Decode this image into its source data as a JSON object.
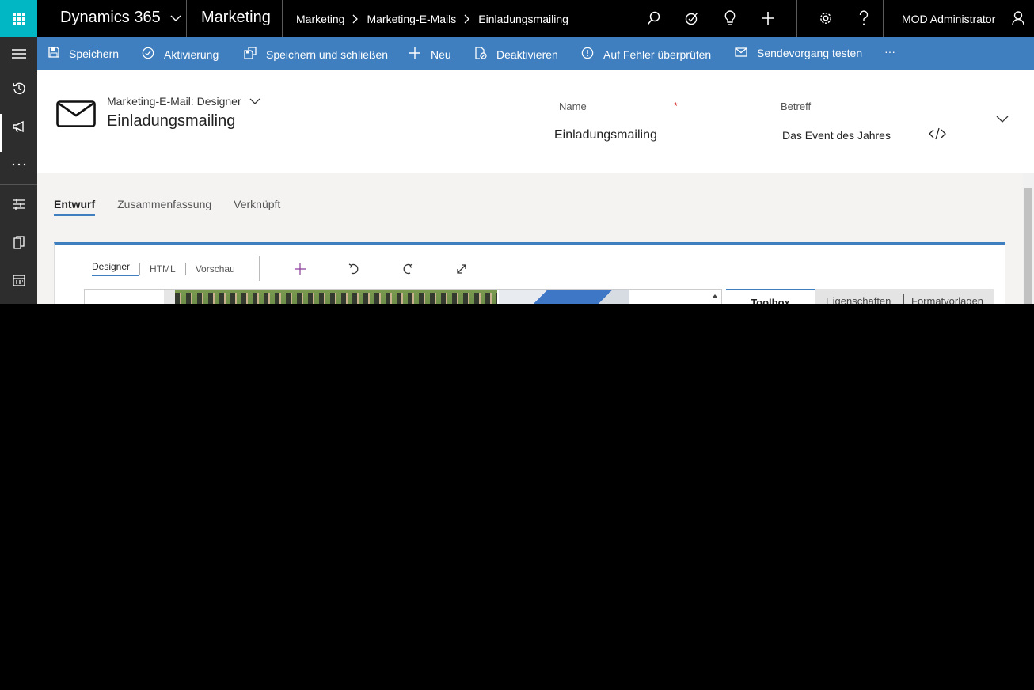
{
  "topbar": {
    "app_name": "Dynamics 365",
    "module": "Marketing",
    "breadcrumbs": [
      "Marketing",
      "Marketing-E-Mails",
      "Einladungsmailing"
    ],
    "user": "MOD Administrator",
    "icons": [
      "app-launcher-icon",
      "chevron-down-icon",
      "search-icon",
      "task-flow-icon",
      "lightbulb-icon",
      "plus-icon",
      "gear-icon",
      "help-icon",
      "person-icon"
    ]
  },
  "sidebar": {
    "items": [
      "hamburger-icon",
      "recent-icon",
      "megaphone-icon",
      "more-icon",
      "segments-icon",
      "pages-icon",
      "calendar-icon"
    ]
  },
  "commands": {
    "save": "Speichern",
    "activate": "Aktivierung",
    "save_close": "Speichern und schließen",
    "new": "Neu",
    "deactivate": "Deaktivieren",
    "check_errors": "Auf Fehler überprüfen",
    "test_send": "Sendevorgang testen",
    "more": "···"
  },
  "header": {
    "entity_kind": "Marketing-E-Mail: Designer",
    "title": "Einladungsmailing",
    "name_label": "Name",
    "required_mark": "*",
    "name_value": "Einladungsmailing",
    "subject_label": "Betreff",
    "subject_value": "Das Event des Jahres"
  },
  "tabs": [
    "Entwurf",
    "Zusammenfassung",
    "Verknüpft"
  ],
  "designer": {
    "view_tabs": [
      "Designer",
      "HTML",
      "Vorschau"
    ],
    "toolbar_icons": [
      "add-icon",
      "undo-icon",
      "redo-icon",
      "expand-icon"
    ],
    "right_tabs": [
      "Toolbox",
      "Eigenschaften",
      "Formatvorlagen"
    ]
  },
  "colors": {
    "accent": "#3f7fbf",
    "waffle": "#00b7c3",
    "topbar": "#000000",
    "sidebar": "#2d2d2d"
  }
}
